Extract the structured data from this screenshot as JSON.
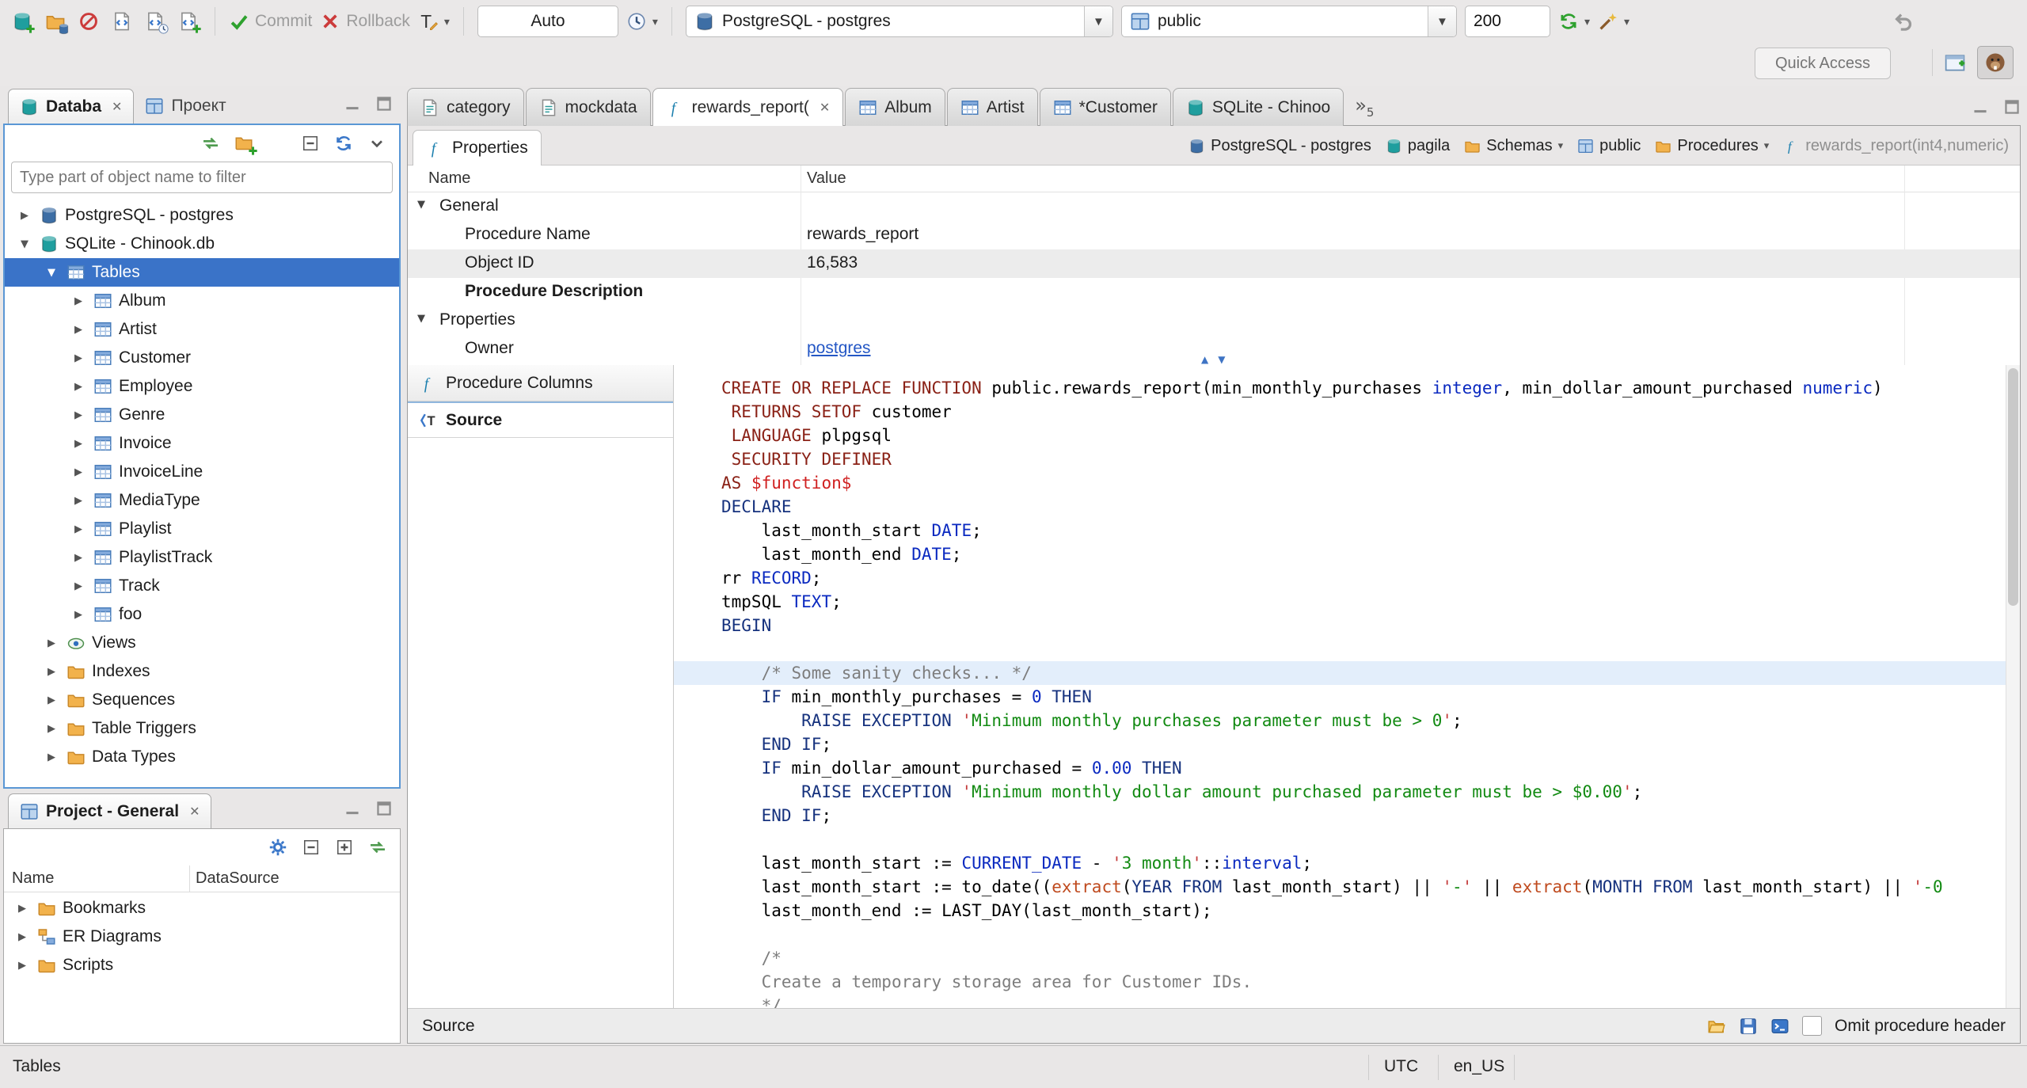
{
  "toolbar": {
    "commit_label": "Commit",
    "rollback_label": "Rollback",
    "auto_mode": "Auto",
    "connection": "PostgreSQL - postgres",
    "schema": "public",
    "fetch_size": "200",
    "quick_access_placeholder": "Quick Access"
  },
  "navigator": {
    "tab_database": "Databa",
    "tab_project": "Проект",
    "filter_placeholder": "Type part of object name to filter",
    "tree": [
      {
        "depth": 0,
        "exp": "closed",
        "icon": "db-postgres",
        "label": "PostgreSQL - postgres"
      },
      {
        "depth": 0,
        "exp": "open",
        "icon": "db-sqlite",
        "label": "SQLite - Chinook.db"
      },
      {
        "depth": 1,
        "exp": "open",
        "icon": "table",
        "label": "Tables",
        "selected": true
      },
      {
        "depth": 2,
        "exp": "closed",
        "icon": "table",
        "label": "Album"
      },
      {
        "depth": 2,
        "exp": "closed",
        "icon": "table",
        "label": "Artist"
      },
      {
        "depth": 2,
        "exp": "closed",
        "icon": "table",
        "label": "Customer"
      },
      {
        "depth": 2,
        "exp": "closed",
        "icon": "table",
        "label": "Employee"
      },
      {
        "depth": 2,
        "exp": "closed",
        "icon": "table",
        "label": "Genre"
      },
      {
        "depth": 2,
        "exp": "closed",
        "icon": "table",
        "label": "Invoice"
      },
      {
        "depth": 2,
        "exp": "closed",
        "icon": "table",
        "label": "InvoiceLine"
      },
      {
        "depth": 2,
        "exp": "closed",
        "icon": "table",
        "label": "MediaType"
      },
      {
        "depth": 2,
        "exp": "closed",
        "icon": "table",
        "label": "Playlist"
      },
      {
        "depth": 2,
        "exp": "closed",
        "icon": "table",
        "label": "PlaylistTrack"
      },
      {
        "depth": 2,
        "exp": "closed",
        "icon": "table",
        "label": "Track"
      },
      {
        "depth": 2,
        "exp": "closed",
        "icon": "table",
        "label": "foo"
      },
      {
        "depth": 1,
        "exp": "closed",
        "icon": "view",
        "label": "Views"
      },
      {
        "depth": 1,
        "exp": "closed",
        "icon": "folder",
        "label": "Indexes"
      },
      {
        "depth": 1,
        "exp": "closed",
        "icon": "folder",
        "label": "Sequences"
      },
      {
        "depth": 1,
        "exp": "closed",
        "icon": "folder",
        "label": "Table Triggers"
      },
      {
        "depth": 1,
        "exp": "closed",
        "icon": "folder",
        "label": "Data Types"
      }
    ]
  },
  "project_panel": {
    "title": "Project - General",
    "columns": [
      "Name",
      "DataSource"
    ],
    "items": [
      {
        "icon": "bookmarks",
        "label": "Bookmarks"
      },
      {
        "icon": "diagram",
        "label": "ER Diagrams"
      },
      {
        "icon": "scripts",
        "label": "Scripts"
      }
    ]
  },
  "editor": {
    "tabs": [
      {
        "icon": "script",
        "label": "category"
      },
      {
        "icon": "script",
        "label": "mockdata"
      },
      {
        "icon": "function",
        "label": "rewards_report(",
        "active": true
      },
      {
        "icon": "table",
        "label": "Album"
      },
      {
        "icon": "table",
        "label": "Artist"
      },
      {
        "icon": "table",
        "label": "*Customer"
      },
      {
        "icon": "db-sqlite",
        "label": "SQLite - Chinoo"
      }
    ],
    "overflow_count": "5",
    "properties_tab_label": "Properties",
    "breadcrumb": [
      {
        "icon": "db-postgres",
        "label": "PostgreSQL - postgres"
      },
      {
        "icon": "db-sqlite",
        "label": "pagila"
      },
      {
        "icon": "folder",
        "label": "Schemas",
        "dropdown": true
      },
      {
        "icon": "schema",
        "label": "public"
      },
      {
        "icon": "folder",
        "label": "Procedures",
        "dropdown": true
      },
      {
        "icon": "function",
        "label": "rewards_report(int4,numeric)",
        "dim": true
      }
    ],
    "grid": {
      "name_header": "Name",
      "value_header": "Value",
      "rows": [
        {
          "group": true,
          "name": "General"
        },
        {
          "name": "Procedure Name",
          "value": "rewards_report"
        },
        {
          "name": "Object ID",
          "value": "16,583",
          "shaded": true
        },
        {
          "name": "Procedure Description",
          "value": "",
          "bold": true
        },
        {
          "group": true,
          "name": "Properties"
        },
        {
          "name": "Owner",
          "value": "postgres",
          "link": true
        }
      ]
    },
    "subtabs": [
      {
        "icon": "function",
        "label": "Procedure Columns"
      },
      {
        "icon": "source",
        "label": "Source",
        "active": true
      }
    ],
    "bottom": {
      "label": "Source",
      "omit_label": "Omit procedure header",
      "checked": false
    }
  },
  "code": {
    "lines": [
      {
        "s": [
          [
            "k1",
            "CREATE OR REPLACE FUNCTION"
          ],
          [
            "t",
            " public.rewards_report(min_monthly_purchases "
          ],
          [
            "ty",
            "integer"
          ],
          [
            "t",
            ", min_dollar_amount_purchased "
          ],
          [
            "ty",
            "numeric"
          ],
          [
            "t",
            ")"
          ]
        ]
      },
      {
        "s": [
          [
            "t",
            " "
          ],
          [
            "k1",
            "RETURNS SETOF"
          ],
          [
            "t",
            " customer"
          ]
        ]
      },
      {
        "s": [
          [
            "t",
            " "
          ],
          [
            "k1",
            "LANGUAGE"
          ],
          [
            "t",
            " plpgsql"
          ]
        ]
      },
      {
        "s": [
          [
            "t",
            " "
          ],
          [
            "k1",
            "SECURITY DEFINER"
          ]
        ]
      },
      {
        "s": [
          [
            "k1",
            "AS"
          ],
          [
            "t",
            " "
          ],
          [
            "dl",
            "$function$"
          ]
        ]
      },
      {
        "s": [
          [
            "k2",
            "DECLARE"
          ]
        ]
      },
      {
        "s": [
          [
            "t",
            "    last_month_start "
          ],
          [
            "ty",
            "DATE"
          ],
          [
            "t",
            ";"
          ]
        ]
      },
      {
        "s": [
          [
            "t",
            "    last_month_end "
          ],
          [
            "ty",
            "DATE"
          ],
          [
            "t",
            ";"
          ]
        ]
      },
      {
        "s": [
          [
            "t",
            "rr "
          ],
          [
            "ty",
            "RECORD"
          ],
          [
            "t",
            ";"
          ]
        ]
      },
      {
        "s": [
          [
            "t",
            "tmpSQL "
          ],
          [
            "ty",
            "TEXT"
          ],
          [
            "t",
            ";"
          ]
        ]
      },
      {
        "s": [
          [
            "k2",
            "BEGIN"
          ]
        ]
      },
      {
        "s": []
      },
      {
        "hl": true,
        "s": [
          [
            "t",
            "    "
          ],
          [
            "cm",
            "/* Some sanity checks... */"
          ]
        ]
      },
      {
        "s": [
          [
            "t",
            "    "
          ],
          [
            "k2",
            "IF"
          ],
          [
            "t",
            " min_monthly_purchases = "
          ],
          [
            "num",
            "0"
          ],
          [
            "t",
            " "
          ],
          [
            "k2",
            "THEN"
          ]
        ]
      },
      {
        "s": [
          [
            "t",
            "        "
          ],
          [
            "k2",
            "RAISE EXCEPTION"
          ],
          [
            "t",
            " "
          ],
          [
            "sq",
            "'"
          ],
          [
            "str",
            "Minimum monthly purchases parameter must be > 0"
          ],
          [
            "sq",
            "'"
          ],
          [
            "t",
            ";"
          ]
        ]
      },
      {
        "s": [
          [
            "t",
            "    "
          ],
          [
            "k2",
            "END IF"
          ],
          [
            "t",
            ";"
          ]
        ]
      },
      {
        "s": [
          [
            "t",
            "    "
          ],
          [
            "k2",
            "IF"
          ],
          [
            "t",
            " min_dollar_amount_purchased = "
          ],
          [
            "num",
            "0.00"
          ],
          [
            "t",
            " "
          ],
          [
            "k2",
            "THEN"
          ]
        ]
      },
      {
        "s": [
          [
            "t",
            "        "
          ],
          [
            "k2",
            "RAISE EXCEPTION"
          ],
          [
            "t",
            " "
          ],
          [
            "sq",
            "'"
          ],
          [
            "str",
            "Minimum monthly dollar amount purchased parameter must be > $0.00"
          ],
          [
            "sq",
            "'"
          ],
          [
            "t",
            ";"
          ]
        ]
      },
      {
        "s": [
          [
            "t",
            "    "
          ],
          [
            "k2",
            "END IF"
          ],
          [
            "t",
            ";"
          ]
        ]
      },
      {
        "s": []
      },
      {
        "s": [
          [
            "t",
            "    last_month_start := "
          ],
          [
            "ty",
            "CURRENT_DATE"
          ],
          [
            "t",
            " - "
          ],
          [
            "sq",
            "'"
          ],
          [
            "str",
            "3 month"
          ],
          [
            "sq",
            "'"
          ],
          [
            "t",
            "::"
          ],
          [
            "ty",
            "interval"
          ],
          [
            "t",
            ";"
          ]
        ]
      },
      {
        "s": [
          [
            "t",
            "    last_month_start := to_date(("
          ],
          [
            "fn",
            "extract"
          ],
          [
            "t",
            "("
          ],
          [
            "k2",
            "YEAR"
          ],
          [
            "t",
            " "
          ],
          [
            "k2",
            "FROM"
          ],
          [
            "t",
            " last_month_start) || "
          ],
          [
            "sq",
            "'"
          ],
          [
            "str",
            "-"
          ],
          [
            "sq",
            "'"
          ],
          [
            "t",
            " || "
          ],
          [
            "fn",
            "extract"
          ],
          [
            "t",
            "("
          ],
          [
            "k2",
            "MONTH"
          ],
          [
            "t",
            " "
          ],
          [
            "k2",
            "FROM"
          ],
          [
            "t",
            " last_month_start) || "
          ],
          [
            "sq",
            "'"
          ],
          [
            "str",
            "-0"
          ]
        ]
      },
      {
        "s": [
          [
            "t",
            "    last_month_end := LAST_DAY(last_month_start);"
          ]
        ]
      },
      {
        "s": []
      },
      {
        "s": [
          [
            "t",
            "    "
          ],
          [
            "cm",
            "/*"
          ]
        ]
      },
      {
        "s": [
          [
            "t",
            "    "
          ],
          [
            "cm",
            "Create a temporary storage area for Customer IDs."
          ]
        ]
      },
      {
        "s": [
          [
            "t",
            "    "
          ],
          [
            "cm",
            "*/"
          ]
        ]
      }
    ]
  },
  "status_bar": {
    "context": "Tables",
    "timezone": "UTC",
    "locale": "en_US"
  }
}
